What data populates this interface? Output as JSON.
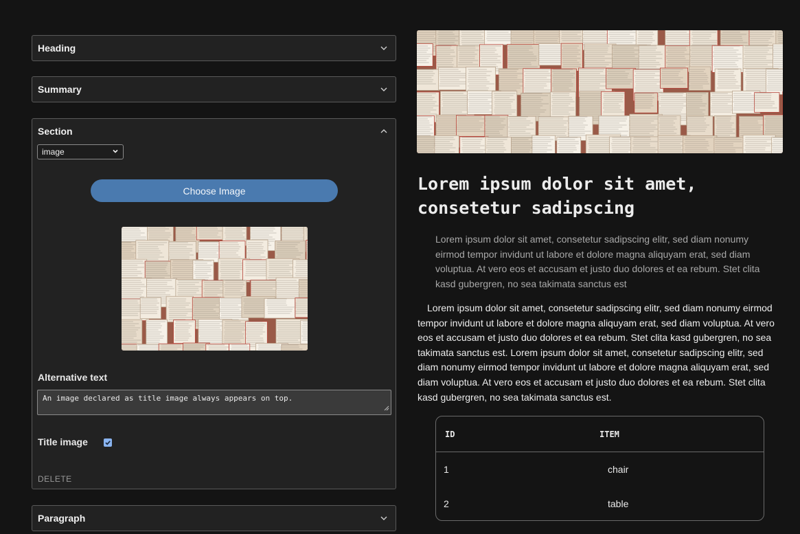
{
  "editor": {
    "accordions": {
      "heading": {
        "label": "Heading"
      },
      "summary": {
        "label": "Summary"
      },
      "section": {
        "label": "Section"
      },
      "paragraph": {
        "label": "Paragraph"
      }
    },
    "section": {
      "type_select_value": "image",
      "choose_image_label": "Choose Image",
      "alt_text_label": "Alternative text",
      "alt_text_value": "An image declared as title image always appears on top.",
      "title_image_label": "Title image",
      "title_image_checked": true,
      "delete_label": "DELETE"
    }
  },
  "preview": {
    "title": "Lorem ipsum dolor sit amet, consetetur sadipscing",
    "summary": "Lorem ipsum dolor sit amet, consetetur sadipscing elitr, sed diam nonumy eirmod tempor invidunt ut labore et dolore magna aliquyam erat, sed diam voluptua. At vero eos et accusam et justo duo dolores et ea rebum. Stet clita kasd gubergren, no sea takimata sanctus est",
    "paragraph": "Lorem ipsum dolor sit amet, consetetur sadipscing elitr, sed diam nonumy eirmod tempor invidunt ut labore et dolore magna aliquyam erat, sed diam voluptua. At vero eos et accusam et justo duo dolores et ea rebum. Stet clita kasd gubergren, no sea takimata sanctus est. Lorem ipsum dolor sit amet, consetetur sadipscing elitr, sed diam nonumy eirmod tempor invidunt ut labore et dolore magna aliquyam erat, sed diam voluptua. At vero eos et accusam et justo duo dolores et ea rebum. Stet clita kasd gubergren, no sea takimata sanctus est.",
    "table": {
      "headers": [
        "ID",
        "ITEM"
      ],
      "rows": [
        [
          "1",
          "chair"
        ],
        [
          "2",
          "table"
        ]
      ]
    }
  },
  "colors": {
    "background": "#141414",
    "panel": "#222222",
    "accent_button": "#4a7aaf",
    "checkbox": "#8ab4f0"
  },
  "icons": {
    "collapsed": "chevron-down-icon",
    "expanded": "chevron-up-icon",
    "select_arrow": "chevron-down-icon"
  }
}
